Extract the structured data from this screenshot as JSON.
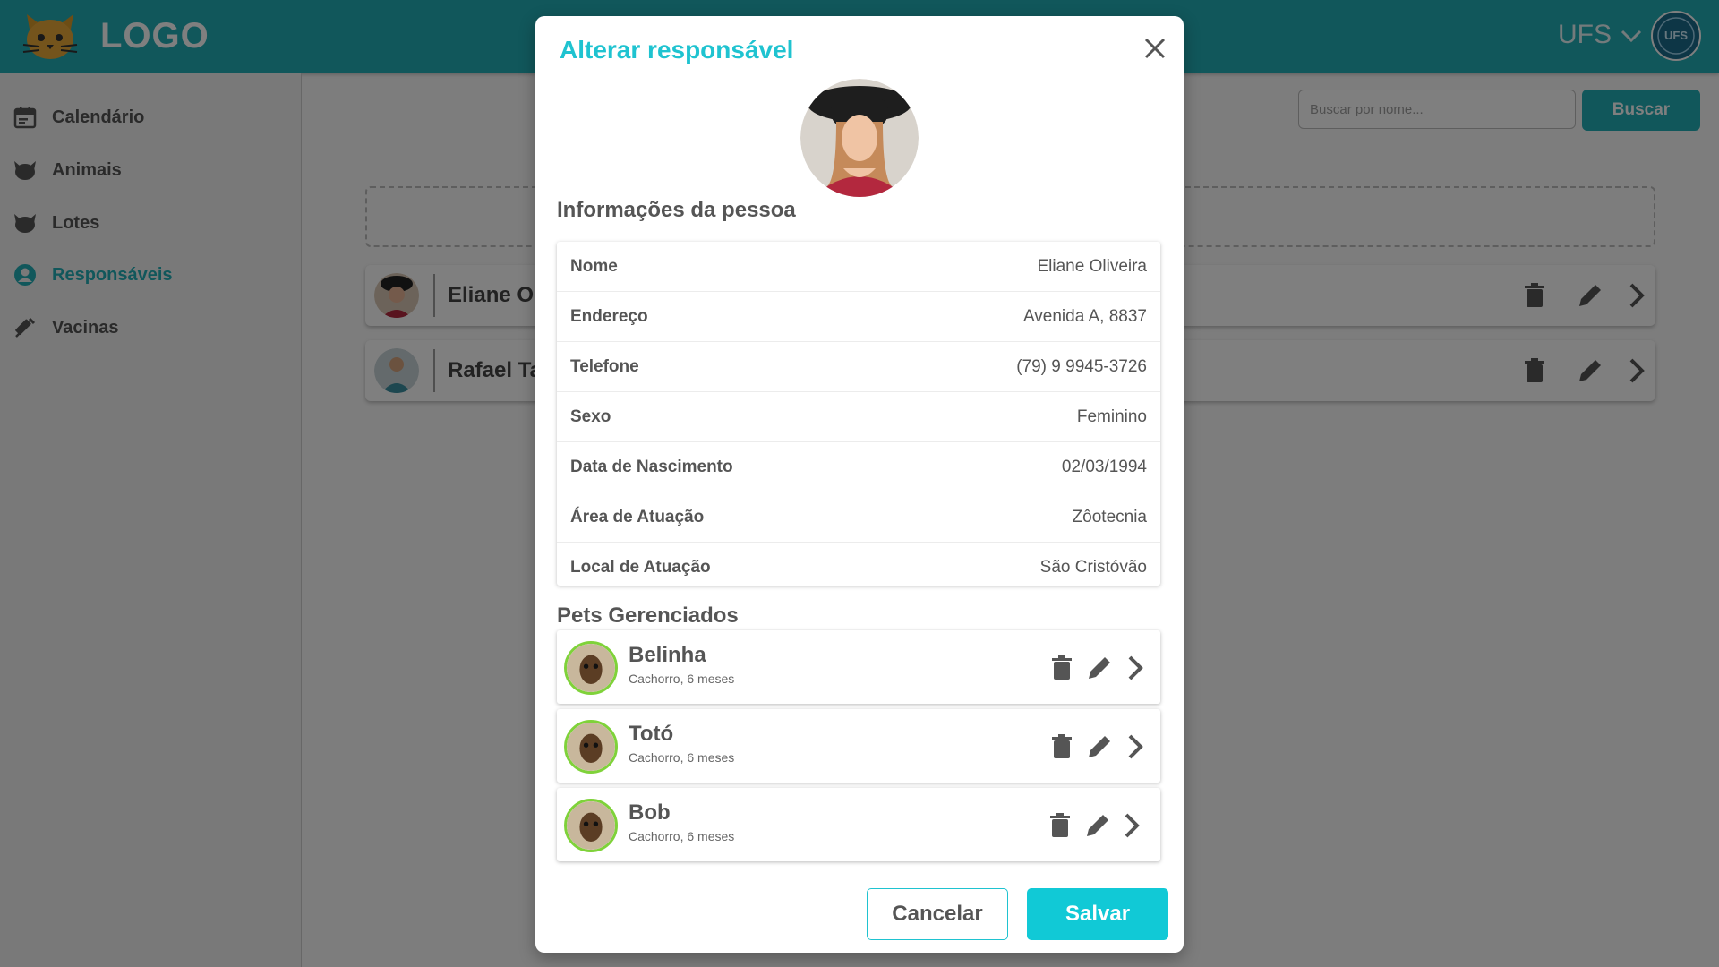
{
  "header": {
    "logo_text": "LOGO",
    "org_name": "UFS",
    "org_avatar_text": "UFS"
  },
  "sidebar": {
    "items": [
      {
        "label": "Calendário",
        "icon": "calendar-icon",
        "active": false
      },
      {
        "label": "Animais",
        "icon": "cat-icon",
        "active": false
      },
      {
        "label": "Lotes",
        "icon": "cat-icon",
        "active": false
      },
      {
        "label": "Responsáveis",
        "icon": "person-circle-icon",
        "active": true
      },
      {
        "label": "Vacinas",
        "icon": "syringe-icon",
        "active": false
      }
    ]
  },
  "main": {
    "search_placeholder": "Buscar por nome...",
    "search_button": "Buscar",
    "people": [
      {
        "name": "Eliane Oli"
      },
      {
        "name": "Rafael Ta"
      }
    ]
  },
  "modal": {
    "title": "Alterar responsável",
    "section_info": "Informações da pessoa",
    "fields": [
      {
        "label": "Nome",
        "value": "Eliane Oliveira"
      },
      {
        "label": "Endereço",
        "value": "Avenida A, 8837"
      },
      {
        "label": "Telefone",
        "value": "(79) 9 9945-3726"
      },
      {
        "label": "Sexo",
        "value": "Feminino"
      },
      {
        "label": "Data de Nascimento",
        "value": "02/03/1994"
      },
      {
        "label": "Área de Atuação",
        "value": "Zôotecnia"
      },
      {
        "label": "Local de Atuação",
        "value": "São Cristóvão"
      }
    ],
    "section_pets": "Pets Gerenciados",
    "pets": [
      {
        "name": "Belinha",
        "desc": "Cachorro, 6 meses"
      },
      {
        "name": "Totó",
        "desc": "Cachorro, 6 meses"
      },
      {
        "name": "Bob",
        "desc": "Cachorro, 6 meses"
      }
    ],
    "cancel_label": "Cancelar",
    "save_label": "Salvar"
  },
  "colors": {
    "primary": "#23aeb6",
    "accent": "#11c9d6",
    "pet_ring": "#7fd23a",
    "text": "#555555"
  }
}
